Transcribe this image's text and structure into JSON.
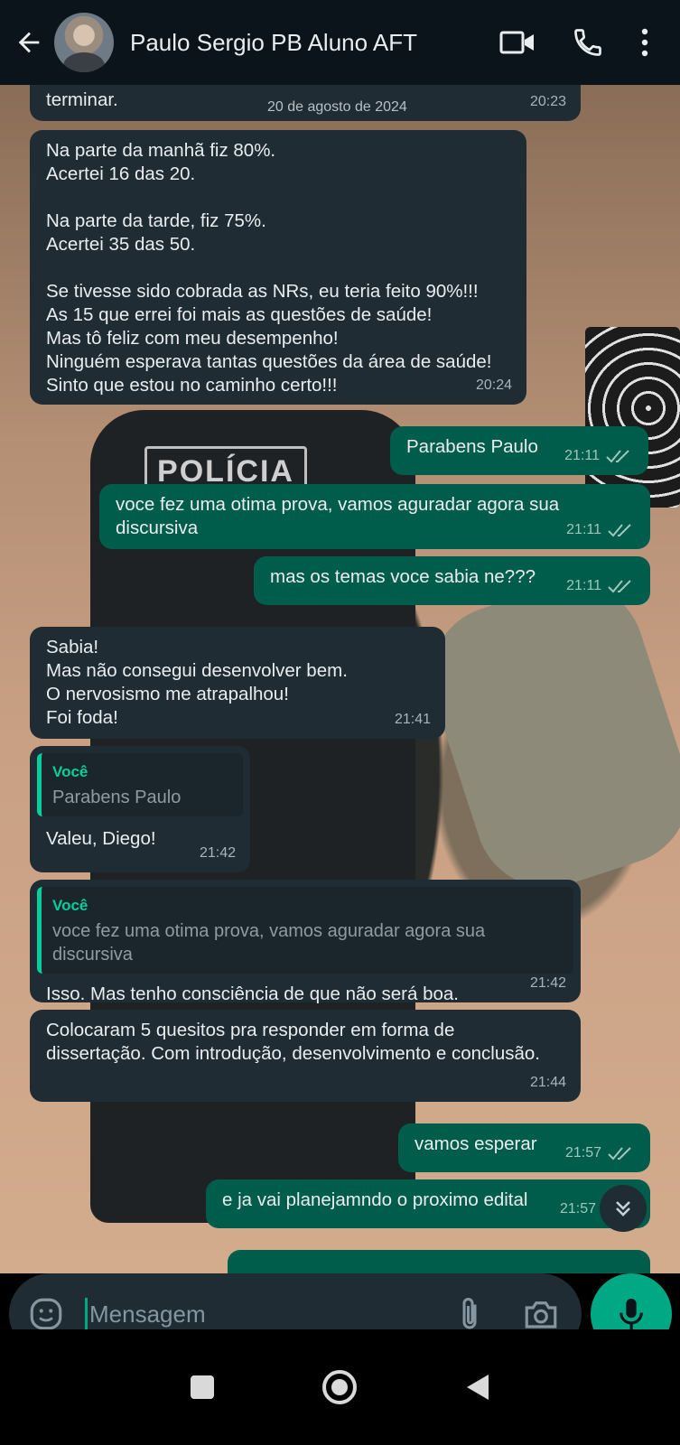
{
  "header": {
    "contact_name": "Paulo Sergio PB Aluno AFT",
    "icons": [
      "back-arrow-icon",
      "avatar",
      "video-call-icon",
      "phone-icon",
      "more-icon"
    ]
  },
  "chat": {
    "date_chip": "20 de agosto de 2024",
    "messages": [
      {
        "dir": "in",
        "text": "terminar.",
        "time": "20:23"
      },
      {
        "dir": "in",
        "text": "Na parte da manhã fiz 80%.\nAcertei 16 das 20.\n\nNa parte da tarde, fiz 75%.\nAcertei 35 das 50.\n\nSe tivesse sido cobrada as NRs, eu teria feito 90%!!!\nAs 15 que errei foi mais as questões de saúde!\nMas tô feliz com meu desempenho!\nNinguém esperava tantas questões da área de saúde!\nSinto que estou no caminho certo!!!",
        "time": "20:24"
      },
      {
        "dir": "out",
        "text": "Parabens Paulo",
        "time": "21:11"
      },
      {
        "dir": "out",
        "text": "voce fez uma otima prova, vamos aguradar agora sua discursiva",
        "time": "21:11"
      },
      {
        "dir": "out",
        "text": "mas os temas voce sabia ne???",
        "time": "21:11"
      },
      {
        "dir": "in",
        "text": "Sabia!\nMas não consegui desenvolver bem.\nO nervosismo me atrapalhou!\nFoi foda!",
        "time": "21:41"
      },
      {
        "dir": "in",
        "quote_author": "Você",
        "quote_text": "Parabens Paulo",
        "text": "Valeu, Diego!",
        "time": "21:42"
      },
      {
        "dir": "in",
        "quote_author": "Você",
        "quote_text": "voce fez uma otima prova, vamos aguradar agora sua discursiva",
        "text": "Isso. Mas tenho consciência de que não será boa.",
        "time": "21:42"
      },
      {
        "dir": "in",
        "text": "Colocaram 5 quesitos pra responder em forma de dissertação. Com introdução, desenvolvimento e conclusão.",
        "time": "21:44"
      },
      {
        "dir": "out",
        "text": "vamos esperar",
        "time": "21:57"
      },
      {
        "dir": "out",
        "text": "e ja vai planejamndo o proximo edital",
        "time": "21:57"
      }
    ],
    "wallpaper_label": "POLÍCIA"
  },
  "composer": {
    "placeholder": "Mensagem",
    "icons": [
      "emoji-icon",
      "attach-icon",
      "camera-icon",
      "mic-icon"
    ]
  },
  "colors": {
    "incoming": "#1f2c34",
    "outgoing": "#005c4b",
    "accent": "#00a884",
    "header": "#0b141a"
  }
}
